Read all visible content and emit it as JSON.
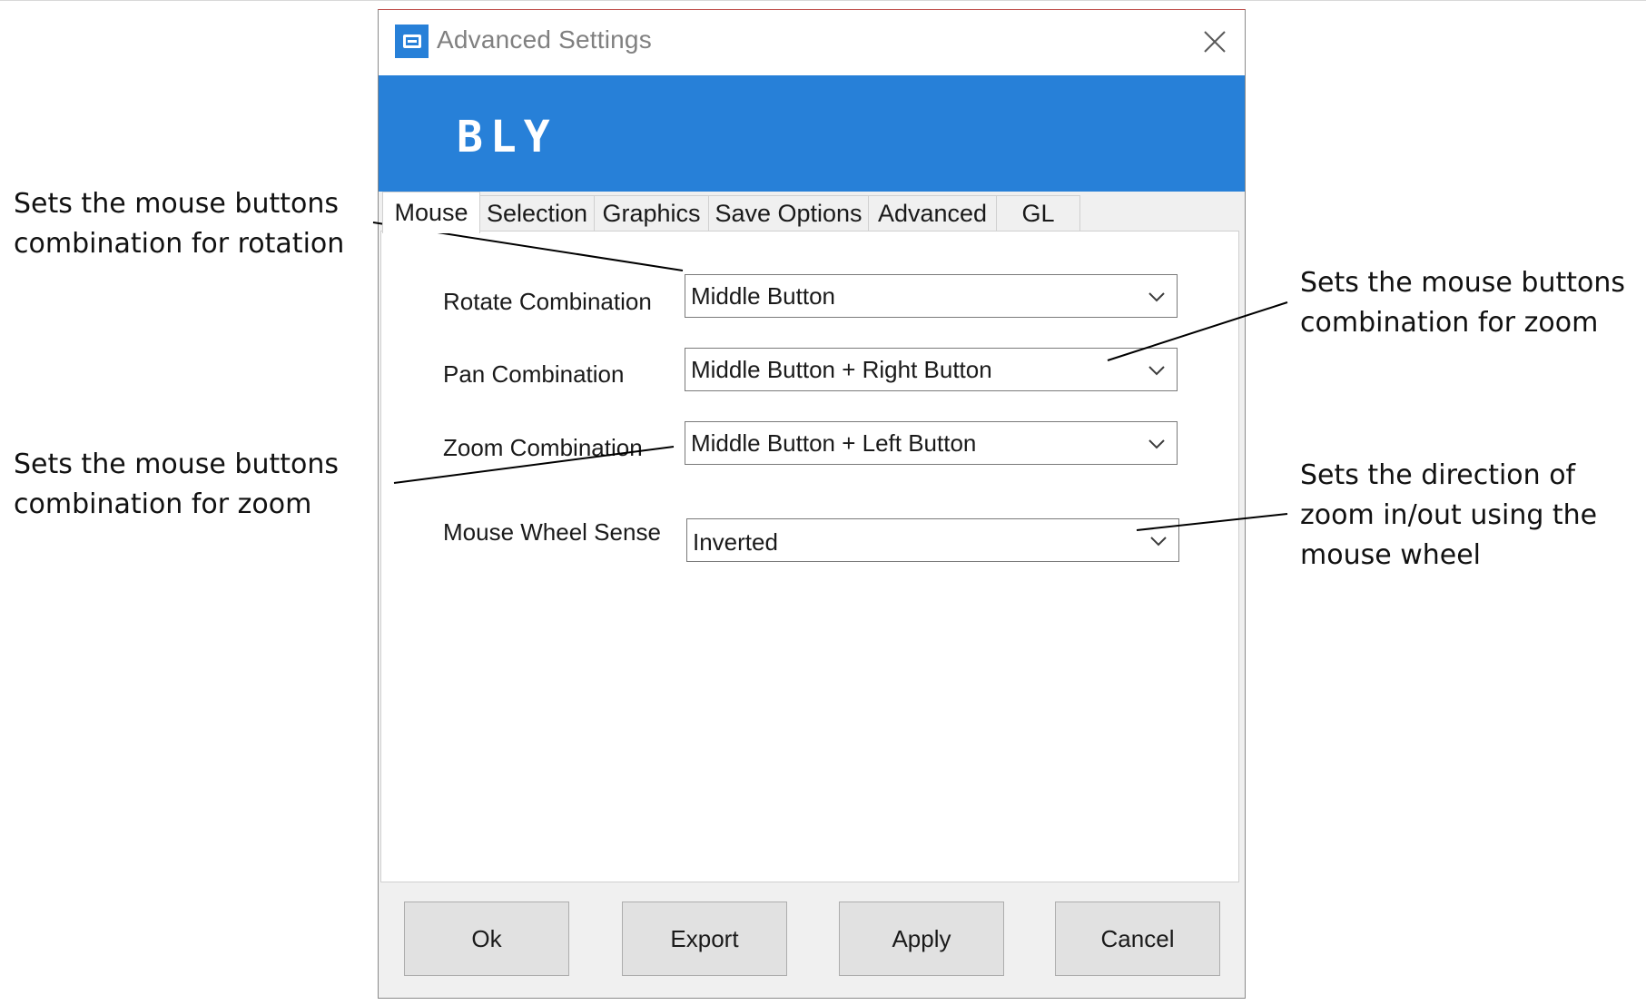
{
  "window": {
    "title": "Advanced Settings",
    "icon": "app-b-icon",
    "close_icon": "close-icon",
    "accent_color": "#2780d8"
  },
  "banner": {
    "logo_text": "BLY"
  },
  "tabs": [
    {
      "label": "Mouse",
      "active": true
    },
    {
      "label": "Selection",
      "active": false
    },
    {
      "label": "Graphics",
      "active": false
    },
    {
      "label": "Save Options",
      "active": false
    },
    {
      "label": "Advanced",
      "active": false
    },
    {
      "label": "GL",
      "active": false
    }
  ],
  "mouse": {
    "rotate": {
      "label": "Rotate Combination",
      "value": "Middle Button"
    },
    "pan": {
      "label": "Pan Combination",
      "value": "Middle Button + Right Button"
    },
    "zoom": {
      "label": "Zoom Combination",
      "value": "Middle Button + Left Button"
    },
    "wheel": {
      "label": "Mouse Wheel Sense",
      "value": "Inverted"
    }
  },
  "buttons": {
    "ok": "Ok",
    "export": "Export",
    "apply": "Apply",
    "cancel": "Cancel"
  },
  "annotations": {
    "rotate": [
      "Sets the mouse buttons",
      "combination for rotation"
    ],
    "pan": [
      "Sets the mouse buttons",
      "combination for zoom"
    ],
    "zoom": [
      "Sets the mouse buttons",
      "combination for zoom"
    ],
    "wheel": [
      "Sets the direction of",
      "zoom in/out using the",
      "mouse wheel"
    ]
  }
}
